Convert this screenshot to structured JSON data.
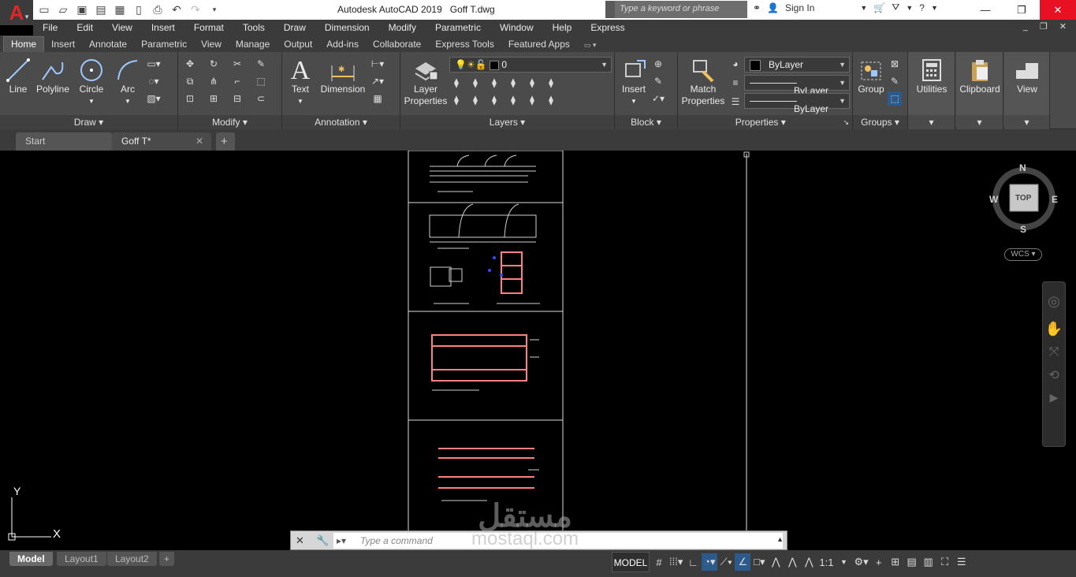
{
  "app": {
    "title": "Autodesk AutoCAD 2019",
    "file_name": "Goff T.dwg",
    "logo_letter": "A"
  },
  "search": {
    "placeholder": "Type a keyword or phrase"
  },
  "account": {
    "sign_in": "Sign In"
  },
  "menu": [
    "File",
    "Edit",
    "View",
    "Insert",
    "Format",
    "Tools",
    "Draw",
    "Dimension",
    "Modify",
    "Parametric",
    "Window",
    "Help",
    "Express"
  ],
  "ribbon_tabs": [
    "Home",
    "Insert",
    "Annotate",
    "Parametric",
    "View",
    "Manage",
    "Output",
    "Add-ins",
    "Collaborate",
    "Express Tools",
    "Featured Apps"
  ],
  "ribbon": {
    "draw": {
      "title": "Draw",
      "line": "Line",
      "polyline": "Polyline",
      "circle": "Circle",
      "arc": "Arc"
    },
    "modify": {
      "title": "Modify"
    },
    "annotation": {
      "title": "Annotation",
      "text": "Text",
      "dimension": "Dimension"
    },
    "layers": {
      "title": "Layers",
      "layer_properties_1": "Layer",
      "layer_properties_2": "Properties",
      "current_layer": "0"
    },
    "block": {
      "title": "Block",
      "insert": "Insert"
    },
    "properties": {
      "title": "Properties",
      "match_1": "Match",
      "match_2": "Properties",
      "color": "ByLayer",
      "linetype": "ByLayer",
      "lineweight": "ByLayer"
    },
    "groups": {
      "title": "Groups",
      "group": "Group"
    },
    "utilities": "Utilities",
    "clipboard": "Clipboard",
    "view": "View"
  },
  "file_tabs": {
    "start": "Start",
    "current": "Goff T*"
  },
  "viewcube": {
    "n": "N",
    "s": "S",
    "e": "E",
    "w": "W",
    "face": "TOP",
    "wcs": "WCS"
  },
  "ucs": {
    "x": "X",
    "y": "Y"
  },
  "command": {
    "placeholder": "Type a command"
  },
  "layout_tabs": [
    "Model",
    "Layout1",
    "Layout2"
  ],
  "status": {
    "model": "MODEL",
    "scale": "1:1"
  },
  "watermark": {
    "arabic": "مستقل",
    "latin": "mostaql.com"
  },
  "colors": {
    "accent": "#e02626",
    "drawing_red": "#ff8080",
    "status_active": "#2c5a8a"
  }
}
